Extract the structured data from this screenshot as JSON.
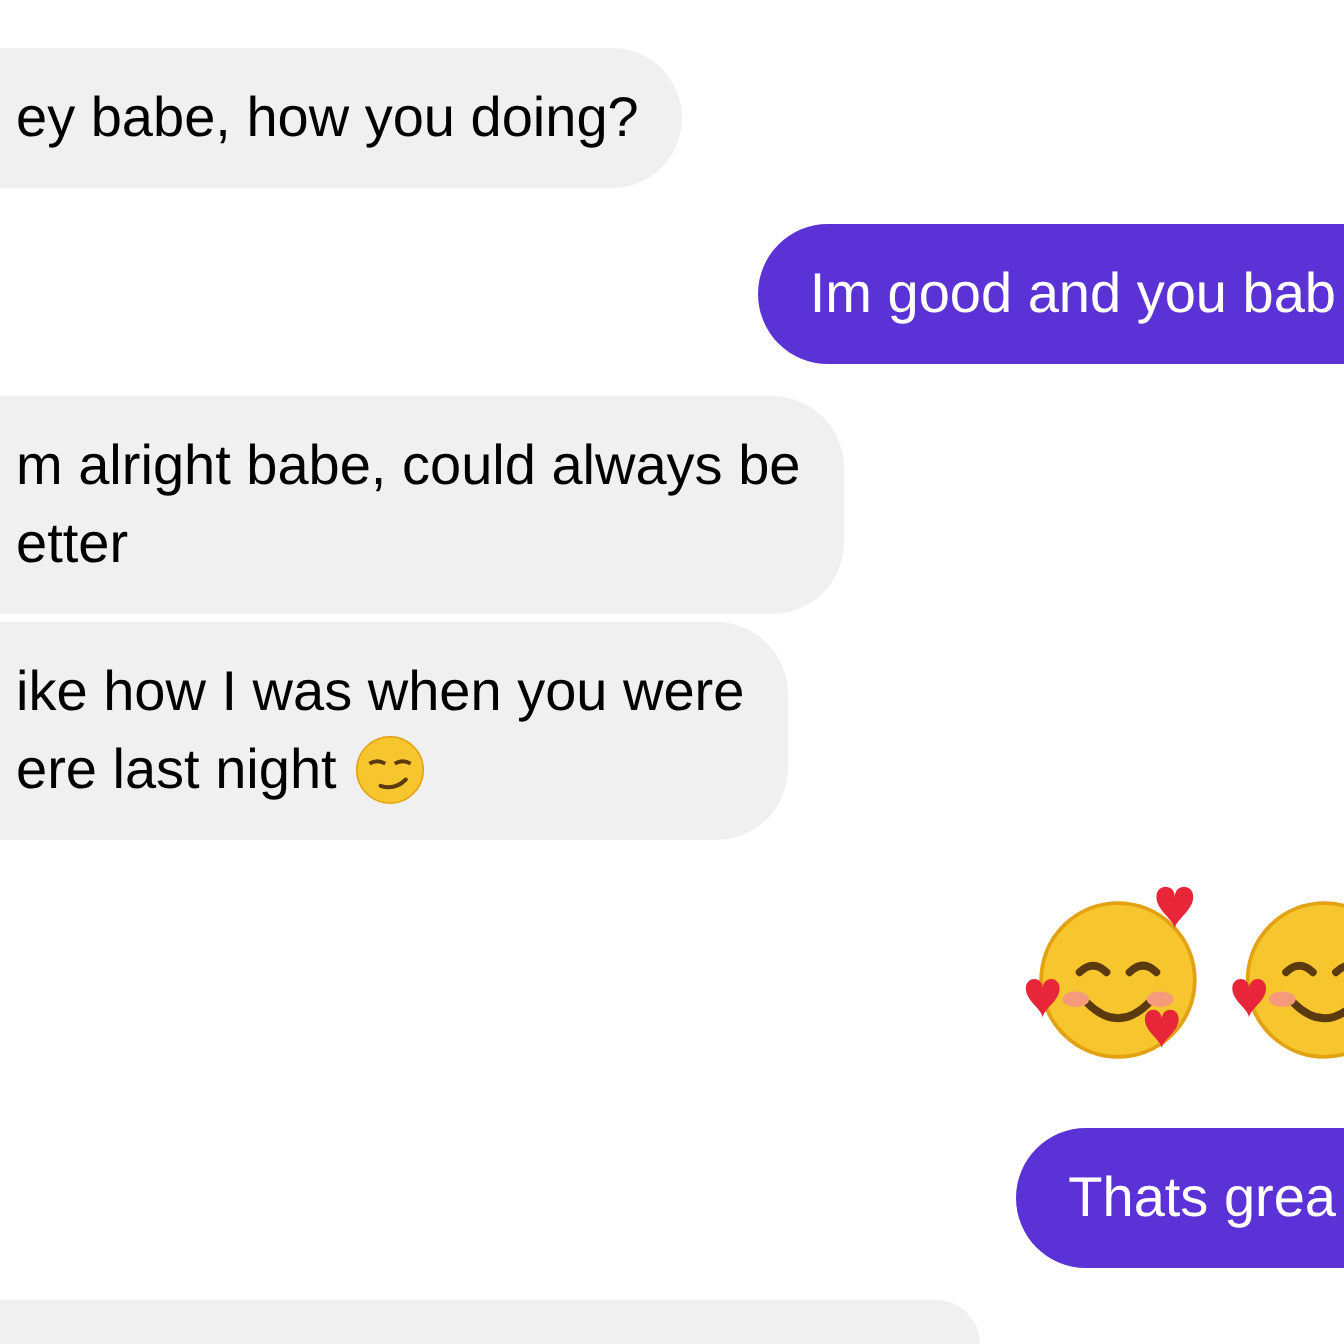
{
  "messages": [
    {
      "kind": "received",
      "lines": [
        "ey babe, how you doing?"
      ]
    },
    {
      "kind": "sent",
      "lines": [
        "Im good and you bab"
      ]
    },
    {
      "kind": "received",
      "lines": [
        "m alright babe, could always be",
        "etter"
      ]
    },
    {
      "kind": "received",
      "lines": [
        "ike how I was when you were",
        "ere last night"
      ],
      "trailing_emoji": true
    },
    {
      "kind": "sent-emoji-pair"
    },
    {
      "kind": "sent",
      "lines": [
        "Thats grea"
      ]
    },
    {
      "kind": "received-cut"
    }
  ]
}
